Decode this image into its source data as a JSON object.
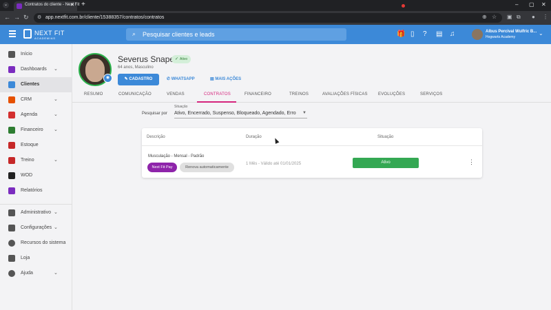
{
  "browser": {
    "tab_title": "Contratos do cliente - Next Fit",
    "url": "app.nextfit.com.br/cliente/15388357/contratos/contratos",
    "new_tab": "+"
  },
  "header": {
    "logo_name": "NEXT FIT",
    "logo_sub": "ACADEMIAS",
    "search_placeholder": "Pesquisar clientes e leads",
    "user_name": "Albus Percival Wulfric B...",
    "user_org": "Hogwarts Academy"
  },
  "sidebar": {
    "items": [
      {
        "label": "Início",
        "icon": "home-icon",
        "color": "#555555"
      },
      {
        "label": "Dashboards",
        "icon": "chart-icon",
        "color": "#7b2cbf"
      },
      {
        "label": "Clientes",
        "icon": "users-icon",
        "color": "#3c89d8"
      },
      {
        "label": "CRM",
        "icon": "crm-icon",
        "color": "#e65100"
      },
      {
        "label": "Agenda",
        "icon": "calendar-icon",
        "color": "#d32f2f"
      },
      {
        "label": "Financeiro",
        "icon": "money-icon",
        "color": "#2e7d32"
      },
      {
        "label": "Estoque",
        "icon": "cart-icon",
        "color": "#c62828"
      },
      {
        "label": "Treino",
        "icon": "dumbbell-icon",
        "color": "#c62828"
      },
      {
        "label": "WOD",
        "icon": "kettlebell-icon",
        "color": "#222222"
      },
      {
        "label": "Relatórios",
        "icon": "report-icon",
        "color": "#7b2cbf"
      },
      {
        "label": "Administrativo",
        "icon": "admin-icon",
        "color": "#555555"
      },
      {
        "label": "Configurações",
        "icon": "gear-icon",
        "color": "#555555"
      },
      {
        "label": "Recursos do sistema",
        "icon": "toggle-icon",
        "color": "#555555"
      },
      {
        "label": "Loja",
        "icon": "shop-icon",
        "color": "#555555"
      },
      {
        "label": "Ajuda",
        "icon": "help-icon",
        "color": "#555555"
      }
    ]
  },
  "profile": {
    "name": "Severus Snape",
    "badge": "Ativo",
    "info": "64 anos, Masculino",
    "btn_cadastro": "CADASTRO",
    "btn_whatsapp": "WHATSAPP",
    "btn_mais": "MAIS AÇÕES"
  },
  "tabs": [
    "RESUMO",
    "COMUNICAÇÃO",
    "VENDAS",
    "CONTRATOS",
    "FINANCEIRO",
    "TREINOS",
    "AVALIAÇÕES FÍSICAS",
    "EVOLUÇÕES",
    "SERVIÇOS"
  ],
  "filter": {
    "label": "Pesquisar por",
    "field_label": "Situação",
    "value": "Ativo, Encerrado, Suspenso, Bloqueado, Agendado, Erro"
  },
  "table": {
    "headers": {
      "descricao": "Descrição",
      "duracao": "Duração",
      "situacao": "Situação"
    },
    "row": {
      "plan": "Musculação - Mensal - Padrão",
      "chip_pay": "Next Fit Pay",
      "chip_renew": "Renova automaticamente",
      "duration": "1 Mês - Válido até 01/01/2025",
      "status": "Ativo"
    }
  },
  "colors": {
    "primary": "#3c89d8",
    "active_tab": "#d4237b",
    "status": "#34a853",
    "chip_pay": "#8e24aa"
  }
}
